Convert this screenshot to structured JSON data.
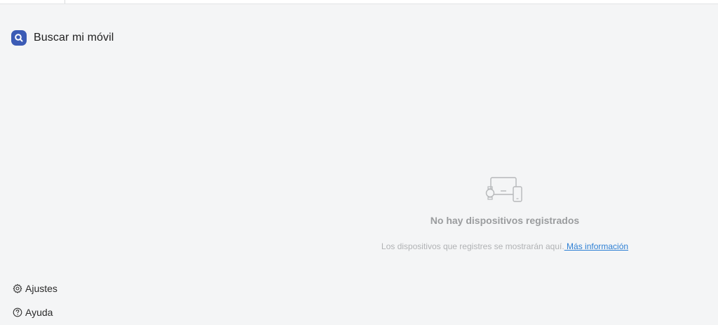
{
  "app": {
    "title": "Buscar mi móvil",
    "logo_icon": "find-my-mobile-logo",
    "accent_color": "#3b5bb5"
  },
  "empty_state": {
    "illustration_icon": "devices-icon",
    "title": "No hay dispositivos registrados",
    "description": "Los dispositivos que registres se mostrarán aquí.",
    "link_label": " Más información",
    "link_color": "#2d7fd4"
  },
  "sidebar_footer": {
    "settings_label": "Ajustes",
    "settings_icon": "gear-icon",
    "help_label": "Ayuda",
    "help_icon": "help-circle-icon"
  }
}
